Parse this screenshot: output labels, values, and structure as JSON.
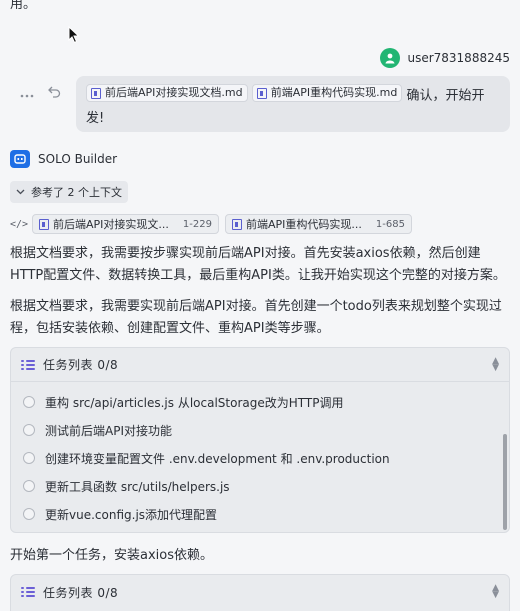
{
  "top_text": "用。",
  "user": {
    "name": "user7831888245"
  },
  "message": {
    "chips": [
      {
        "label": "前后端API对接实现文档.md"
      },
      {
        "label": "前端API重构代码实现.md"
      }
    ],
    "text": "确认，开始开发!"
  },
  "builder": {
    "name": "SOLO Builder"
  },
  "references": {
    "toggle_label": "参考了 2 个上下文",
    "items": [
      {
        "label": "前后端API对接实现文...",
        "range": "1-229"
      },
      {
        "label": "前端API重构代码实现...",
        "range": "1-685"
      }
    ]
  },
  "paragraphs": [
    "根据文档要求，我需要按步骤实现前后端API对接。首先安装axios依赖，然后创建HTTP配置文件、数据转换工具，最后重构API类。让我开始实现这个完整的对接方案。",
    "根据文档要求，我需要实现前后端API对接。首先创建一个todo列表来规划整个实现过程，包括安装依赖、创建配置文件、重构API类等步骤。",
    "开始第一个任务，安装axios依赖。"
  ],
  "task_panel_1": {
    "title": "任务列表 0/8",
    "items": [
      "重构 src/api/articles.js 从localStorage改为HTTP调用",
      "测试前后端API对接功能",
      "创建环境变量配置文件 .env.development 和 .env.production",
      "更新工具函数 src/utils/helpers.js",
      "更新vue.config.js添加代理配置"
    ]
  },
  "task_panel_2": {
    "title": "任务列表 0/8"
  },
  "icons": {
    "avatar": "user-avatar-icon",
    "more": "more-dots-icon",
    "undo": "undo-icon",
    "file": "file-icon",
    "builder": "builder-logo-icon",
    "chevron": "chevron-down-icon",
    "code": "code-icon",
    "list": "task-list-icon",
    "expand": "expand-toggle-icon"
  },
  "colors": {
    "background": "#f5f6f8",
    "bubble": "#e4e6ea",
    "avatar": "#22b573",
    "builder_logo": "#1f6fe5",
    "accent": "#5a5fcf"
  }
}
